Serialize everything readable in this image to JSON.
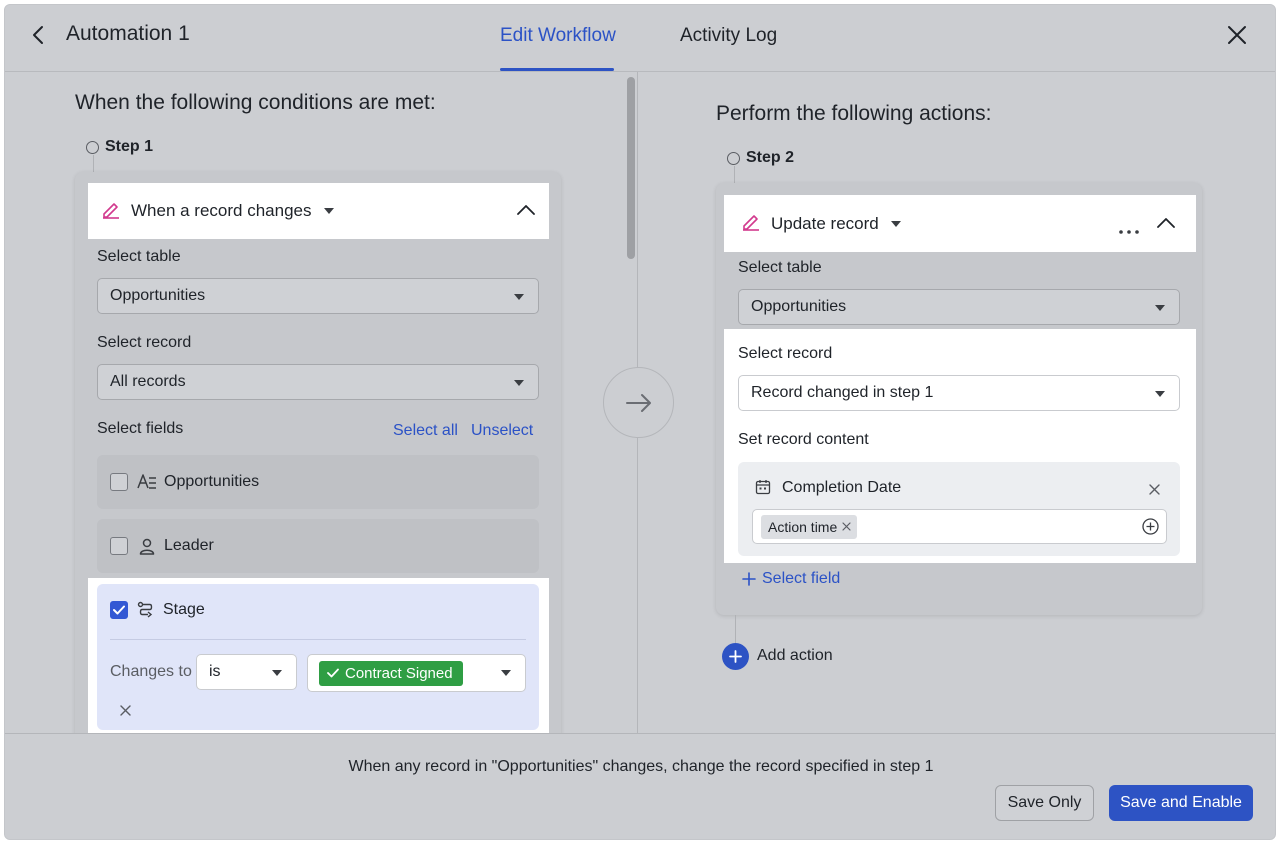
{
  "header": {
    "title": "Automation 1",
    "tabs": [
      {
        "label": "Edit Workflow",
        "active": true
      },
      {
        "label": "Activity Log",
        "active": false
      }
    ]
  },
  "trigger": {
    "section_title": "When the following conditions are met:",
    "step_label": "Step 1",
    "type_label": "When a record changes",
    "select_table_label": "Select table",
    "table_value": "Opportunities",
    "select_record_label": "Select record",
    "record_value": "All records",
    "select_fields_label": "Select fields",
    "select_all": "Select all",
    "unselect": "Unselect",
    "fields": [
      {
        "name": "Opportunities",
        "checked": false,
        "icon": "text-field-icon"
      },
      {
        "name": "Leader",
        "checked": false,
        "icon": "person-icon"
      },
      {
        "name": "Stage",
        "checked": true,
        "icon": "flow-icon"
      }
    ],
    "condition": {
      "label": "Changes to",
      "operator": "is",
      "value": "Contract Signed"
    }
  },
  "action": {
    "section_title": "Perform the following actions:",
    "step_label": "Step 2",
    "type_label": "Update record",
    "select_table_label": "Select table",
    "table_value": "Opportunities",
    "select_record_label": "Select record",
    "record_value": "Record changed in step 1",
    "set_content_label": "Set record content",
    "content_field": "Completion Date",
    "content_chip": "Action time",
    "select_field_link": "Select field",
    "add_action": "Add action"
  },
  "footer": {
    "summary": "When any record in \"Opportunities\" changes, change the record specified in step 1",
    "save_only": "Save Only",
    "save_enable": "Save and Enable"
  },
  "colors": {
    "accent": "#2d53c4",
    "success": "#2f9e44",
    "edit_icon": "#d23a8e"
  }
}
